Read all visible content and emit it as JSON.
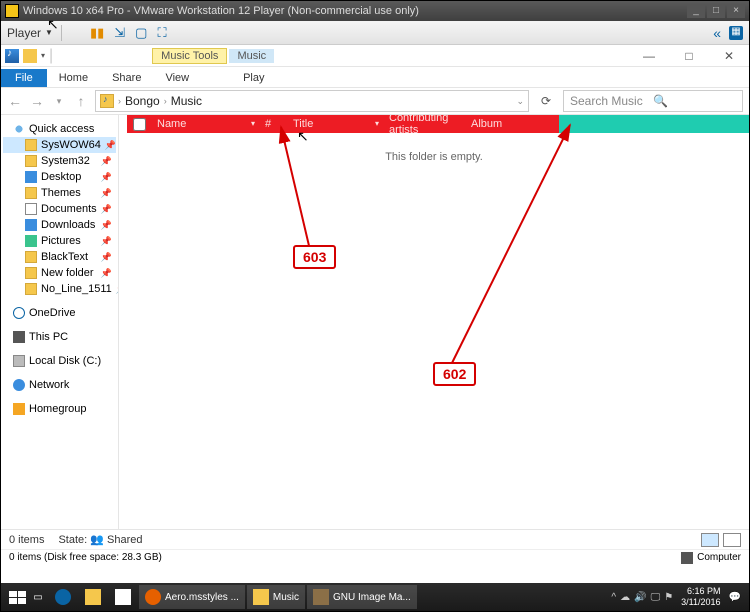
{
  "vm": {
    "title": "Windows 10 x64 Pro - VMware Workstation 12 Player (Non-commercial use only)",
    "player_label": "Player",
    "help_glyph": "«"
  },
  "explorer": {
    "tabs": {
      "music_tools": "Music Tools",
      "music": "Music"
    },
    "ribbon": {
      "file": "File",
      "home": "Home",
      "share": "Share",
      "view": "View",
      "play": "Play"
    },
    "path": {
      "folder": "Bongo",
      "leaf": "Music"
    },
    "search_placeholder": "Search Music",
    "columns": {
      "name": "Name",
      "num": "#",
      "title": "Title",
      "contrib": "Contributing artists",
      "album": "Album"
    },
    "empty_msg": "This folder is empty.",
    "nav": {
      "quick": "Quick access",
      "items": [
        "SysWOW64",
        "System32",
        "Desktop",
        "Themes",
        "Documents",
        "Downloads",
        "Pictures",
        "BlackText",
        "New folder",
        "No_Line_1511"
      ],
      "onedrive": "OneDrive",
      "thispc": "This PC",
      "localdisk": "Local Disk (C:)",
      "network": "Network",
      "homegroup": "Homegroup"
    },
    "status": {
      "items": "0 items",
      "state_label": "State:",
      "state_val": "Shared"
    },
    "diskfree": "0 items (Disk free space: 28.3 GB)",
    "computer": "Computer"
  },
  "taskbar": {
    "apps": [
      {
        "label": "Aero.msstyles ...",
        "kind": "ff"
      },
      {
        "label": "Music",
        "kind": "folder"
      },
      {
        "label": "GNU Image Ma...",
        "kind": "gimp"
      }
    ],
    "time": "6:16 PM",
    "date": "3/11/2016"
  },
  "annotations": {
    "a603": "603",
    "a602": "602"
  }
}
